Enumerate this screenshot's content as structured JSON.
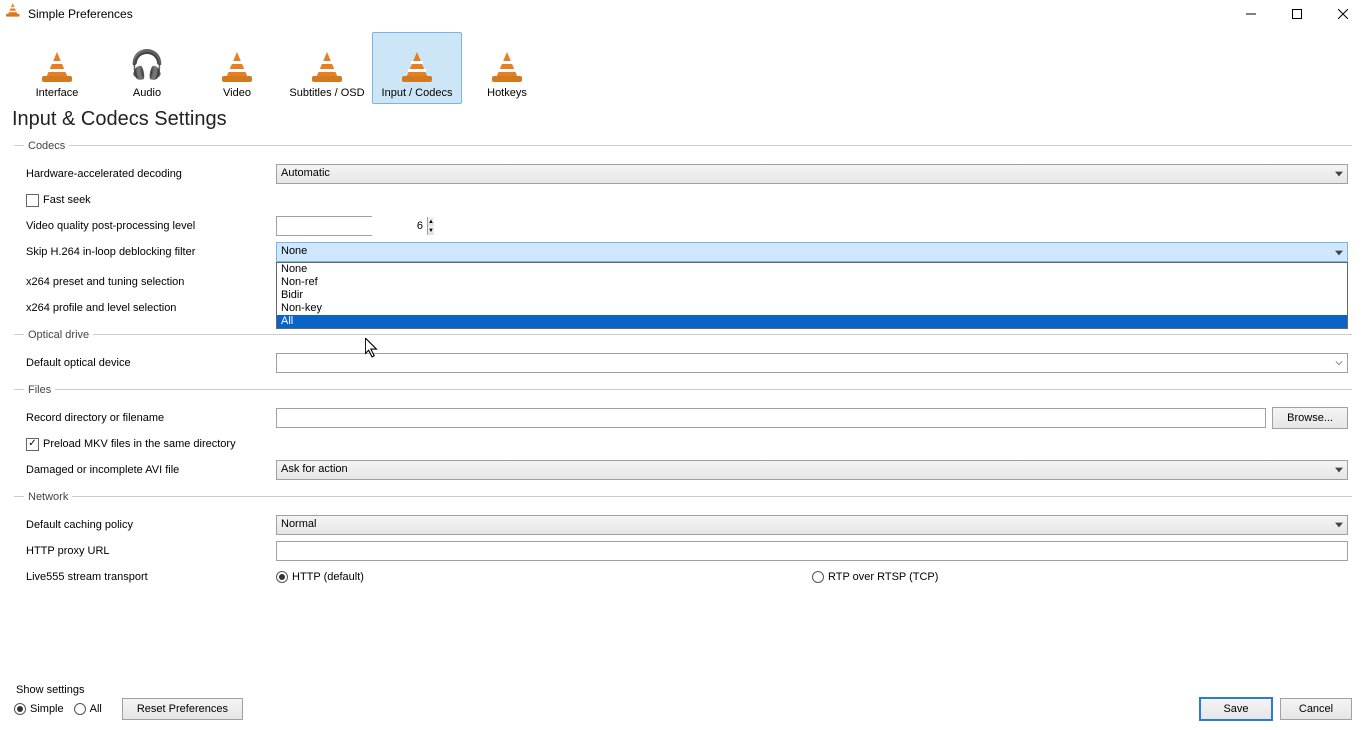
{
  "window_title": "Simple Preferences",
  "tabs": {
    "interface": "Interface",
    "audio": "Audio",
    "video": "Video",
    "subtitles": "Subtitles / OSD",
    "input_codecs": "Input / Codecs",
    "hotkeys": "Hotkeys"
  },
  "page_heading": "Input & Codecs Settings",
  "codecs": {
    "legend": "Codecs",
    "hw_decoding_label": "Hardware-accelerated decoding",
    "hw_decoding_value": "Automatic",
    "fast_seek_label": "Fast seek",
    "fast_seek_checked": false,
    "vq_label": "Video quality post-processing level",
    "vq_value": "6",
    "skip_label": "Skip H.264 in-loop deblocking filter",
    "skip_value": "None",
    "skip_options": [
      "None",
      "Non-ref",
      "Bidir",
      "Non-key",
      "All"
    ],
    "skip_highlight_index": 4,
    "x264_preset_label": "x264 preset and tuning selection",
    "x264_profile_label": "x264 profile and level selection"
  },
  "optical": {
    "legend": "Optical drive",
    "default_device_label": "Default optical device",
    "default_device_value": ""
  },
  "files": {
    "legend": "Files",
    "record_label": "Record directory or filename",
    "record_value": "",
    "browse_label": "Browse...",
    "preload_label": "Preload MKV files in the same directory",
    "preload_checked": true,
    "avi_label": "Damaged or incomplete AVI file",
    "avi_value": "Ask for action"
  },
  "network": {
    "legend": "Network",
    "caching_label": "Default caching policy",
    "caching_value": "Normal",
    "proxy_label": "HTTP proxy URL",
    "proxy_value": "",
    "live555_label": "Live555 stream transport",
    "live555_http": "HTTP (default)",
    "live555_rtsp": "RTP over RTSP (TCP)"
  },
  "bottom": {
    "show_settings": "Show settings",
    "simple": "Simple",
    "all": "All",
    "reset": "Reset Preferences",
    "save": "Save",
    "cancel": "Cancel"
  }
}
